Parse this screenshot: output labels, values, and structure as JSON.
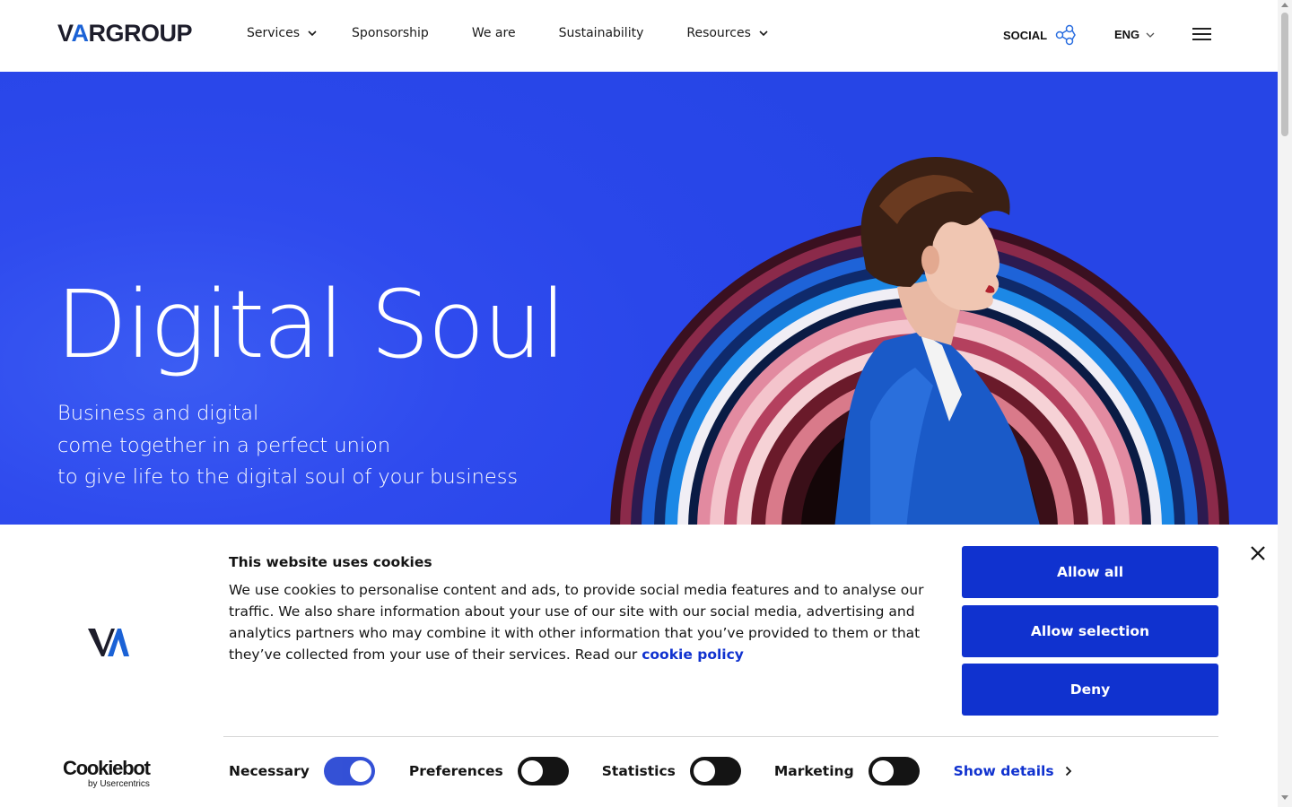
{
  "header": {
    "logo_text_pre": "V",
    "logo_text_a": "A",
    "logo_text_post": "RGROUP",
    "nav": [
      {
        "label": "Services",
        "has_dropdown": true
      },
      {
        "label": "Sponsorship",
        "has_dropdown": false
      },
      {
        "label": "We are",
        "has_dropdown": false
      },
      {
        "label": "Sustainability",
        "has_dropdown": false
      },
      {
        "label": "Resources",
        "has_dropdown": true
      }
    ],
    "social_label": "SOCIAL",
    "language": "ENG"
  },
  "hero": {
    "title": "Digital Soul",
    "subtitle_lines": [
      "Business and digital",
      "come together in a perfect union",
      "to give life to the digital soul of your business"
    ]
  },
  "cookie_banner": {
    "title": "This website uses cookies",
    "body": "We use cookies to personalise content and ads, to provide social media features and to analyse our traffic. We also share information about your use of our site with our social media, advertising and analytics partners who may combine it with other information that you’ve provided to them or that they’ve collected from your use of their services. Read our ",
    "link_text": "cookie policy",
    "buttons": {
      "allow_all": "Allow all",
      "allow_selection": "Allow selection",
      "deny": "Deny"
    },
    "brand_name": "Cookiebot",
    "brand_by": "by Usercentrics",
    "toggles": [
      {
        "label": "Necessary",
        "checked": true
      },
      {
        "label": "Preferences",
        "checked": false
      },
      {
        "label": "Statistics",
        "checked": false
      },
      {
        "label": "Marketing",
        "checked": false
      }
    ],
    "show_details": "Show details"
  },
  "colors": {
    "hero_blue": "#2a47ea",
    "button_blue": "#1032cf",
    "logo_accent": "#1b62d6"
  },
  "icons": [
    "chevron-down-icon",
    "social-network-icon",
    "hamburger-menu-icon",
    "close-icon",
    "chevron-right-icon",
    "va-logo-icon"
  ]
}
